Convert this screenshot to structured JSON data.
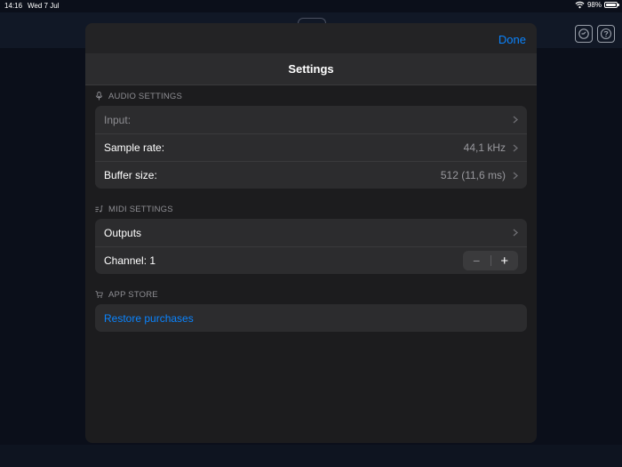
{
  "status_bar": {
    "time": "14:16",
    "date": "Wed 7 Jul",
    "battery_text": "98%",
    "battery_level": 0.98
  },
  "modal": {
    "done_label": "Done",
    "title": "Settings"
  },
  "sections": {
    "audio": {
      "header": "AUDIO SETTINGS",
      "icon": "microphone-icon",
      "rows": {
        "input_label": "Input:",
        "sample_rate_label": "Sample rate:",
        "sample_rate_value": "44,1 kHz",
        "buffer_size_label": "Buffer size:",
        "buffer_size_value": "512 (11,6 ms)"
      }
    },
    "midi": {
      "header": "MIDI SETTINGS",
      "icon": "music-note-list-icon",
      "rows": {
        "outputs_label": "Outputs",
        "channel_label": "Channel: 1",
        "stepper_minus": "−",
        "stepper_plus": "+"
      }
    },
    "app_store": {
      "header": "APP STORE",
      "icon": "cart-icon",
      "rows": {
        "restore_label": "Restore purchases"
      }
    }
  },
  "colors": {
    "accent": "#0a84ff",
    "modal_bg": "#1c1c1e",
    "group_bg": "#2c2c2e",
    "secondary_text": "#8e8e93"
  }
}
